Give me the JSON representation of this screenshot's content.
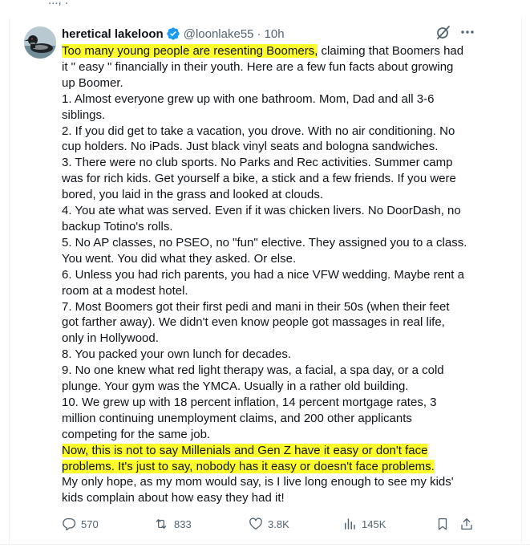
{
  "context": {
    "cut_text": "..., ."
  },
  "tweet": {
    "display_name": "heretical lakeloon",
    "handle": "@loonlake55",
    "separator": "·",
    "time": "10h",
    "verified": true,
    "icons": {
      "grok": "grok-icon",
      "more": "more-options-icon",
      "verified": "verified-badge-icon"
    },
    "colors": {
      "highlight": "#ffff2b",
      "verified": "#1d9bf0",
      "muted": "#536471"
    },
    "lines": [
      {
        "hl": "Too many young people are resenting Boomers,",
        "rest": " claiming that Boomers had"
      },
      {
        "hl": "",
        "rest": "it \" easy \" financially in their youth. Here are a few fun facts about growing"
      },
      {
        "hl": "",
        "rest": "up Boomer."
      },
      {
        "hl": "",
        "rest": "1. Almost everyone grew up with one bathroom. Mom, Dad and all 3-6"
      },
      {
        "hl": "",
        "rest": "siblings."
      },
      {
        "hl": "",
        "rest": "2. If you did get to take a vacation, you drove. With no air conditioning. No"
      },
      {
        "hl": "",
        "rest": "cup holders. No iPads. Just black vinyl seats and bologna sandwiches."
      },
      {
        "hl": "",
        "rest": "3. There were no club sports. No Parks and Rec activities. Summer camp"
      },
      {
        "hl": "",
        "rest": "was for rich kids. Get yourself a bike, a stick and a few friends. If you were"
      },
      {
        "hl": "",
        "rest": "bored, you laid in the grass and looked at clouds."
      },
      {
        "hl": "",
        "rest": "4. You ate what was served. Even if it was chicken livers.  No DoorDash, no"
      },
      {
        "hl": "",
        "rest": "backup Totino's rolls."
      },
      {
        "hl": "",
        "rest": "5. No AP classes, no PSEO, no \"fun\" elective. They assigned you to a class."
      },
      {
        "hl": "",
        "rest": "You went. You did what they asked. Or else."
      },
      {
        "hl": "",
        "rest": "6. Unless you had rich parents, you had a nice VFW wedding. Maybe rent a"
      },
      {
        "hl": "",
        "rest": "room at a modest hotel."
      },
      {
        "hl": "",
        "rest": "7. Most Boomers got their first pedi and mani in their 50s (when their feet"
      },
      {
        "hl": "",
        "rest": "got farther away). We didn't even know people got massages in real life,"
      },
      {
        "hl": "",
        "rest": "only in Hollywood."
      },
      {
        "hl": "",
        "rest": "8. You packed your own lunch for decades."
      },
      {
        "hl": "",
        "rest": "9. No one knew what red light therapy was, a facial, a spa day, or a cold"
      },
      {
        "hl": "",
        "rest": "plunge. Your gym was the YMCA. Usually in a rather old building."
      },
      {
        "hl": "",
        "rest": "10. We grew up with 18 percent inflation, 14 percent mortgage rates, 3"
      },
      {
        "hl": "",
        "rest": "million continuing unemployment claims, and 200 other applicants"
      },
      {
        "hl": "",
        "rest": "competing for the same job."
      },
      {
        "hl": "Now, this is not to say Millenials and Gen Z have it easy or don't face",
        "rest": ""
      },
      {
        "hl": "problems. It's just to say, nobody has it easy or doesn't face problems.",
        "rest": ""
      },
      {
        "hl": "",
        "rest": "My only hope, as my mom would say, is I live long enough to see my kids'"
      },
      {
        "hl": "",
        "rest": "kids complain about how easy they had it!"
      }
    ],
    "actions": {
      "replies": "570",
      "reposts": "833",
      "likes": "3.8K",
      "views": "145K",
      "icons": [
        "reply-icon",
        "repost-icon",
        "like-icon",
        "views-icon",
        "bookmark-icon",
        "share-icon"
      ]
    }
  }
}
